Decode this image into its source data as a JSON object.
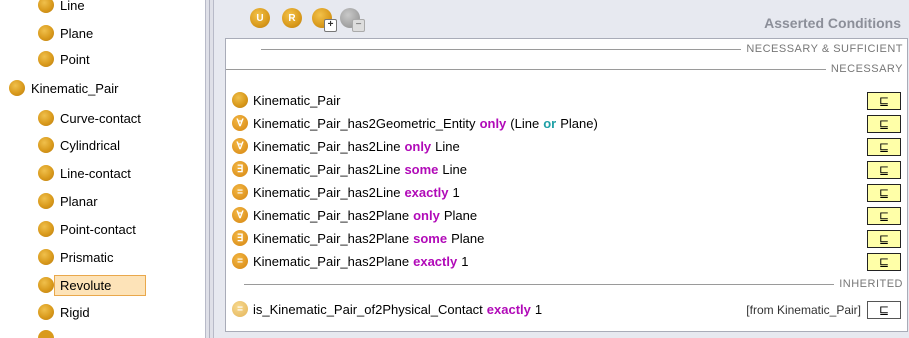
{
  "tree": {
    "items": [
      {
        "label": "Line",
        "indent": 1
      },
      {
        "label": "Plane",
        "indent": 1
      },
      {
        "label": "Point",
        "indent": 1
      },
      {
        "label": "Kinematic_Pair",
        "indent": 0
      },
      {
        "label": "Curve-contact",
        "indent": 1
      },
      {
        "label": "Cylindrical",
        "indent": 1
      },
      {
        "label": "Line-contact",
        "indent": 1
      },
      {
        "label": "Planar",
        "indent": 1
      },
      {
        "label": "Point-contact",
        "indent": 1
      },
      {
        "label": "Prismatic",
        "indent": 1
      },
      {
        "label": "Revolute",
        "indent": 1,
        "selected": true
      },
      {
        "label": "Rigid",
        "indent": 1
      }
    ]
  },
  "toolbar": {
    "buttons": [
      {
        "name": "add-restriction-button",
        "glyph": "U"
      },
      {
        "name": "add-restriction-r-button",
        "glyph": "R"
      },
      {
        "name": "add-named-class-button",
        "glyph": ""
      },
      {
        "name": "remove-button",
        "glyph": ""
      }
    ]
  },
  "panel": {
    "title": "Asserted Conditions",
    "sections": {
      "necessary_sufficient": "NECESSARY & SUFFICIENT",
      "necessary": "NECESSARY",
      "inherited": "INHERITED"
    },
    "subclass_symbol": "⊑",
    "necessary_rows": [
      {
        "icon": "class",
        "glyph": "",
        "subject": "Kinematic_Pair",
        "keyword": "",
        "object": ""
      },
      {
        "icon": "restr",
        "glyph": "∀",
        "subject": "Kinematic_Pair_has2Geometric_Entity",
        "keyword": "only",
        "object_pre": "(Line",
        "or": "or",
        "object": "Plane)"
      },
      {
        "icon": "restr",
        "glyph": "∀",
        "subject": "Kinematic_Pair_has2Line",
        "keyword": "only",
        "object": "Line"
      },
      {
        "icon": "restr",
        "glyph": "∃",
        "subject": "Kinematic_Pair_has2Line",
        "keyword": "some",
        "object": "Line"
      },
      {
        "icon": "restr",
        "glyph": "=",
        "subject": "Kinematic_Pair_has2Line",
        "keyword": "exactly",
        "object": "1"
      },
      {
        "icon": "restr",
        "glyph": "∀",
        "subject": "Kinematic_Pair_has2Plane",
        "keyword": "only",
        "object": "Plane"
      },
      {
        "icon": "restr",
        "glyph": "∃",
        "subject": "Kinematic_Pair_has2Plane",
        "keyword": "some",
        "object": "Plane"
      },
      {
        "icon": "restr",
        "glyph": "=",
        "subject": "Kinematic_Pair_has2Plane",
        "keyword": "exactly",
        "object": "1"
      }
    ],
    "inherited_rows": [
      {
        "icon": "inh",
        "glyph": "=",
        "subject": "is_Kinematic_Pair_of2Physical_Contact",
        "keyword": "exactly",
        "object": "1",
        "from": "[from Kinematic_Pair]"
      }
    ]
  },
  "colors": {
    "class_icon": "#d99a1c",
    "keyword": "#b10ab8",
    "or_keyword": "#1ea0a6",
    "subclass_button": "#ffffa8",
    "selection": "#fde3b8",
    "panel_bg": "#e7e9f0"
  }
}
